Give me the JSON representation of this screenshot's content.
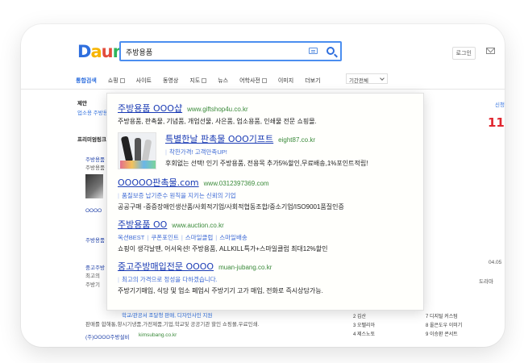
{
  "header": {
    "logo_letters": [
      "D",
      "a",
      "u",
      "m"
    ],
    "search_query": "주방용품",
    "login_label": "로그인"
  },
  "tabs": [
    {
      "label": "통합검색",
      "active": true,
      "box": false
    },
    {
      "label": "쇼핑",
      "active": false,
      "box": true
    },
    {
      "label": "사이트",
      "active": false,
      "box": false
    },
    {
      "label": "동영상",
      "active": false,
      "box": false
    },
    {
      "label": "지도",
      "active": false,
      "box": true
    },
    {
      "label": "뉴스",
      "active": false,
      "box": false
    },
    {
      "label": "어학사전",
      "active": false,
      "box": true
    },
    {
      "label": "이미지",
      "active": false,
      "box": false
    },
    {
      "label": "더보기",
      "active": false,
      "box": false
    }
  ],
  "period_select": "기간전체",
  "background": {
    "suggest_label": "제안",
    "suggest_text": "업소용 주방용품",
    "premium_label": "프리미엄링크",
    "right_top_link": "신청",
    "red_number": "11",
    "bg_items": [
      "주방용품",
      "주방용품",
      "주방용품",
      "OOOO",
      "주방용품",
      "중고주방",
      "최고의",
      "주방기",
      "학교/관공서 조달청 판매, 디자인사인 지원",
      "판매를 합해통,향시기냉품,가전제품,기업,학교및 공공기관 할인 쇼핑몰,우료인쇄.",
      "(주)OOOO주방설비",
      "kimsubang.co.kr",
      "04.05",
      "도라마"
    ],
    "side_list": [
      [
        "2 김산",
        "7 디지털 커스텀"
      ],
      [
        "3 오펠리아",
        "8 올은도우 이미기"
      ],
      [
        "4 제스노토",
        "9 이승환 콘서트"
      ]
    ]
  },
  "ads": [
    {
      "title": "주방용품 OOO샵",
      "url": "www.giftshop4u.co.kr",
      "desc": "주방용품, 판촉물, 기념품, 개업선물, 사은품, 업소용품, 인쇄물 전문 쇼핑몰.",
      "subs": [],
      "thumb": false
    },
    {
      "title": "특별한날 판촉물 OOO기프트",
      "url": "eight87.co.kr",
      "desc": "후회없는 선택! 인기 주방용품, 전용목 추가5%할인,무료배송,1%포인트적립!",
      "subs": [
        "착한가격! 고객만족UP!"
      ],
      "thumb": true
    },
    {
      "title": "OOOOO판촉물.com",
      "url": "www.0312397369.com",
      "desc": "공공구매 -중증장애인생산품/사회적기업/사회적협동조합/중소기업/ISO9001품질인증",
      "subs": [
        "품질보증 납기준수 원칙을 지키는 신뢰의 기업"
      ],
      "thumb": false
    },
    {
      "title": "주방용품 OO",
      "url": "www.auction.co.kr",
      "desc": "쇼핑이 생각날땐, 어서옥션! 주방용품, ALLKILL특가+스마일클럽 최대12%할인",
      "subs": [
        "옥션BEST",
        "쿠폰포인트",
        "스마일클럽",
        "스마일배송"
      ],
      "thumb": false
    },
    {
      "title": "중고주방매입전문 OOOO",
      "url": "muan-jubang.co.kr",
      "desc": "주방기기매입, 식당 및 업소 폐업시 주방기기 고가 매입, 전화로 즉시상담가능.",
      "subs": [
        "최고의 가격으로 정성을 다하겠습니다."
      ],
      "thumb": false
    }
  ],
  "colors": {
    "accent": "#2f6fde",
    "ad_title": "#1a3bb5",
    "ad_url": "#3a8a3a",
    "red": "#e0262f"
  }
}
